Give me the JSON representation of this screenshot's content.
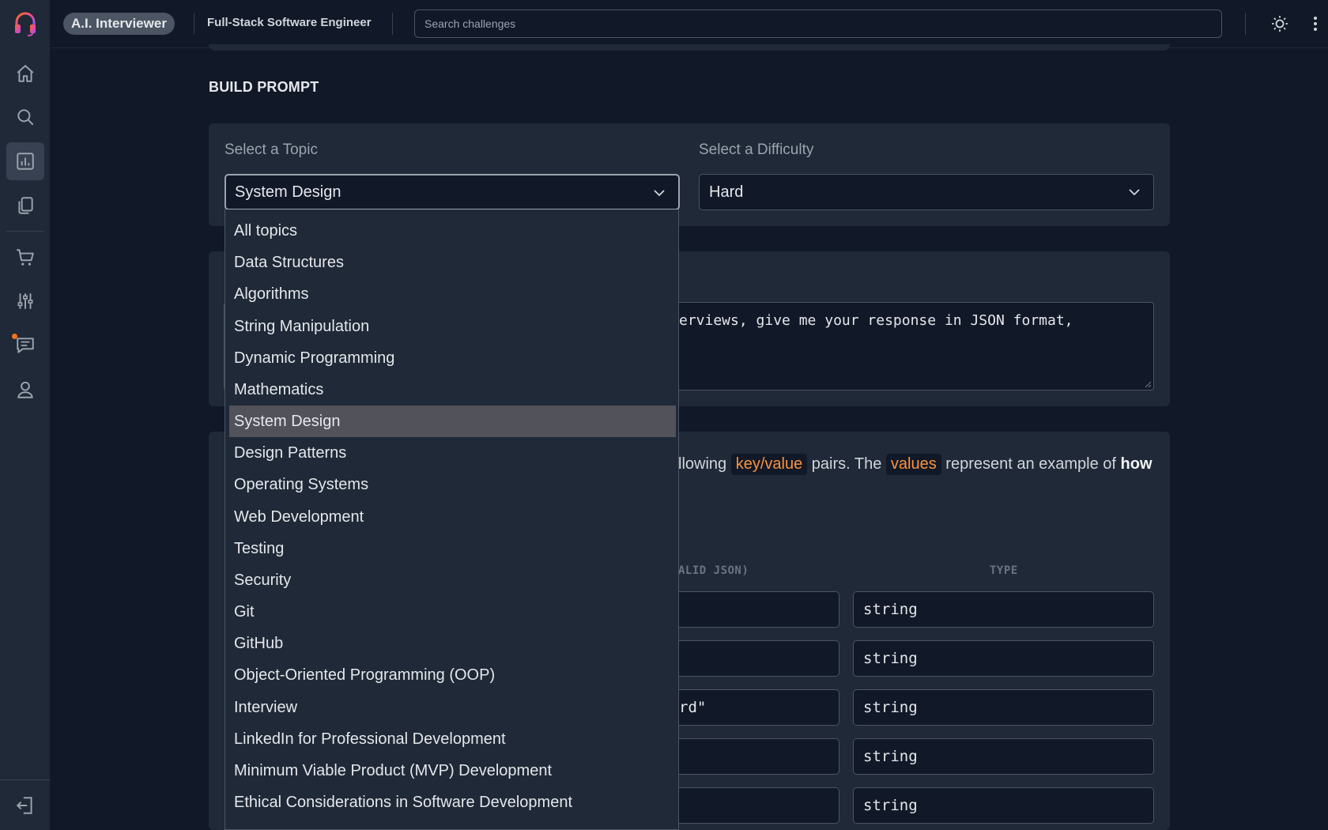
{
  "header": {
    "app_name": "A.I. Interviewer",
    "role_title": "Full-Stack Software Engineer",
    "search_placeholder": "Search challenges"
  },
  "sidebar": {
    "items": [
      {
        "icon": "home-icon"
      },
      {
        "icon": "search-icon"
      },
      {
        "icon": "chart-icon",
        "active": true
      },
      {
        "icon": "documents-icon"
      },
      {
        "icon": "cart-icon"
      },
      {
        "icon": "sliders-icon"
      },
      {
        "icon": "chat-icon",
        "notification": true
      },
      {
        "icon": "user-icon"
      }
    ],
    "bottom": {
      "icon": "logout-icon"
    }
  },
  "main": {
    "section_title": "BUILD PROMPT",
    "topic_label": "Select a Topic",
    "topic_value": "System Design",
    "difficulty_label": "Select a Difficulty",
    "difficulty_value": "Hard",
    "prompt_visible_text": "erviews, give me your response in JSON format,",
    "description": {
      "part1": "llowing",
      "hl1": "key/value",
      "part2": "pairs. The",
      "hl2": "values",
      "part3": "represent an example of",
      "bold": "how"
    },
    "columns": {
      "value_header": "ALID JSON)",
      "type_header": "TYPE"
    },
    "rows": [
      {
        "value": "",
        "type": "string"
      },
      {
        "value": "",
        "type": "string"
      },
      {
        "value": "rd\"",
        "type": "string"
      },
      {
        "value": "",
        "type": "string"
      },
      {
        "value": "",
        "type": "string"
      }
    ]
  },
  "topic_dropdown": {
    "options": [
      "All topics",
      "Data Structures",
      "Algorithms",
      "String Manipulation",
      "Dynamic Programming",
      "Mathematics",
      "System Design",
      "Design Patterns",
      "Operating Systems",
      "Web Development",
      "Testing",
      "Security",
      "Git",
      "GitHub",
      "Object-Oriented Programming (OOP)",
      "Interview",
      "LinkedIn for Professional Development",
      "Minimum Viable Product (MVP) Development",
      "Ethical Considerations in Software Development"
    ],
    "selected": "System Design"
  },
  "colors": {
    "background": "#111827",
    "surface": "#1f2937",
    "accent_orange": "#fb923c",
    "selected_option": "#52525b"
  }
}
